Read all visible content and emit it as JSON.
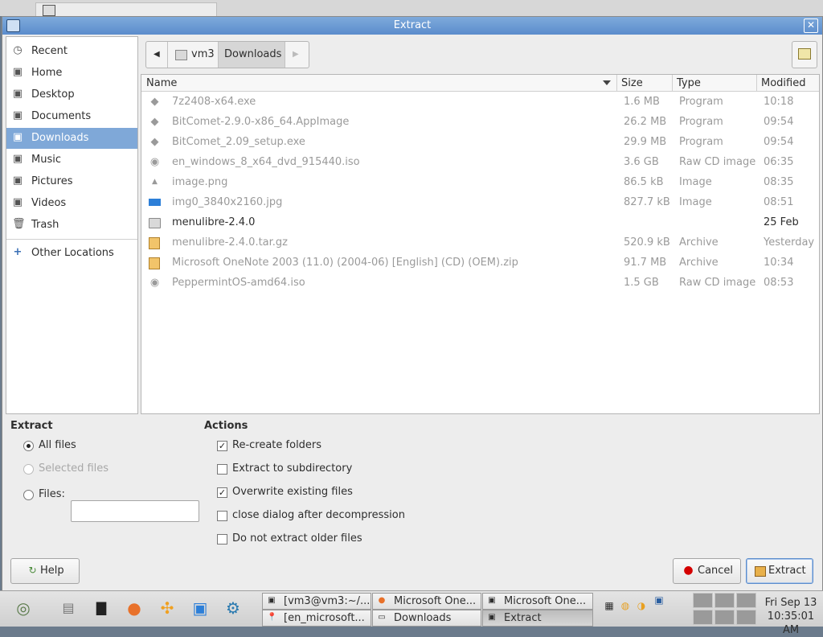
{
  "window": {
    "title": "Extract"
  },
  "sidebar": {
    "items": [
      {
        "label": "Recent",
        "icon": "clock-icon"
      },
      {
        "label": "Home",
        "icon": "home-folder-icon"
      },
      {
        "label": "Desktop",
        "icon": "desktop-folder-icon"
      },
      {
        "label": "Documents",
        "icon": "documents-folder-icon"
      },
      {
        "label": "Downloads",
        "icon": "downloads-folder-icon",
        "selected": true
      },
      {
        "label": "Music",
        "icon": "music-folder-icon"
      },
      {
        "label": "Pictures",
        "icon": "pictures-folder-icon"
      },
      {
        "label": "Videos",
        "icon": "videos-folder-icon"
      },
      {
        "label": "Trash",
        "icon": "trash-icon"
      }
    ],
    "other": {
      "label": "Other Locations",
      "icon": "plus-icon"
    }
  },
  "path": {
    "segments": [
      "vm3",
      "Downloads"
    ]
  },
  "columns": {
    "name": "Name",
    "size": "Size",
    "type": "Type",
    "modified": "Modified"
  },
  "files": [
    {
      "name": "7z2408-x64.exe",
      "size": "1.6 MB",
      "type": "Program",
      "modified": "10:18",
      "icon": "executable-icon"
    },
    {
      "name": "BitComet-2.9.0-x86_64.AppImage",
      "size": "26.2 MB",
      "type": "Program",
      "modified": "09:54",
      "icon": "executable-icon"
    },
    {
      "name": "BitComet_2.09_setup.exe",
      "size": "29.9 MB",
      "type": "Program",
      "modified": "09:54",
      "icon": "executable-icon"
    },
    {
      "name": "en_windows_8_x64_dvd_915440.iso",
      "size": "3.6 GB",
      "type": "Raw CD image",
      "modified": "06:35",
      "icon": "disc-icon"
    },
    {
      "name": "image.png",
      "size": "86.5 kB",
      "type": "Image",
      "modified": "08:35",
      "icon": "image-icon"
    },
    {
      "name": "img0_3840x2160.jpg",
      "size": "827.7 kB",
      "type": "Image",
      "modified": "08:51",
      "icon": "jpg-image-icon"
    },
    {
      "name": "menulibre-2.4.0",
      "size": "",
      "type": "",
      "modified": "25 Feb",
      "icon": "folder-icon",
      "folder": true
    },
    {
      "name": "menulibre-2.4.0.tar.gz",
      "size": "520.9 kB",
      "type": "Archive",
      "modified": "Yesterday",
      "icon": "archive-icon"
    },
    {
      "name": "Microsoft OneNote 2003 (11.0) (2004-06) [English] (CD) (OEM).zip",
      "size": "91.7 MB",
      "type": "Archive",
      "modified": "10:34",
      "icon": "archive-icon"
    },
    {
      "name": "PeppermintOS-amd64.iso",
      "size": "1.5 GB",
      "type": "Raw CD image",
      "modified": "08:53",
      "icon": "disc-icon"
    }
  ],
  "extract": {
    "title": "Extract",
    "all_files": "All files",
    "selected_files": "Selected files",
    "files_label": "Files:",
    "files_value": ""
  },
  "actions": {
    "title": "Actions",
    "recreate": "Re-create folders",
    "subdirectory": "Extract to subdirectory",
    "overwrite": "Overwrite existing files",
    "close_after": "close dialog after decompression",
    "no_older": "Do not extract older files"
  },
  "buttons": {
    "help": "Help",
    "cancel": "Cancel",
    "extract": "Extract"
  },
  "taskbar": {
    "tasks": [
      {
        "label": "[vm3@vm3:~/...",
        "icon": "terminal-icon"
      },
      {
        "label": "Microsoft One...",
        "icon": "firefox-icon"
      },
      {
        "label": "Microsoft One...",
        "icon": "archive-manager-icon"
      },
      {
        "label": "[en_microsoft...",
        "icon": "pin-icon"
      },
      {
        "label": "Downloads",
        "icon": "folder-icon"
      },
      {
        "label": "Extract",
        "icon": "archive-manager-icon"
      }
    ],
    "clock": {
      "date": "Fri Sep 13",
      "time": "10:35:01 AM"
    }
  }
}
